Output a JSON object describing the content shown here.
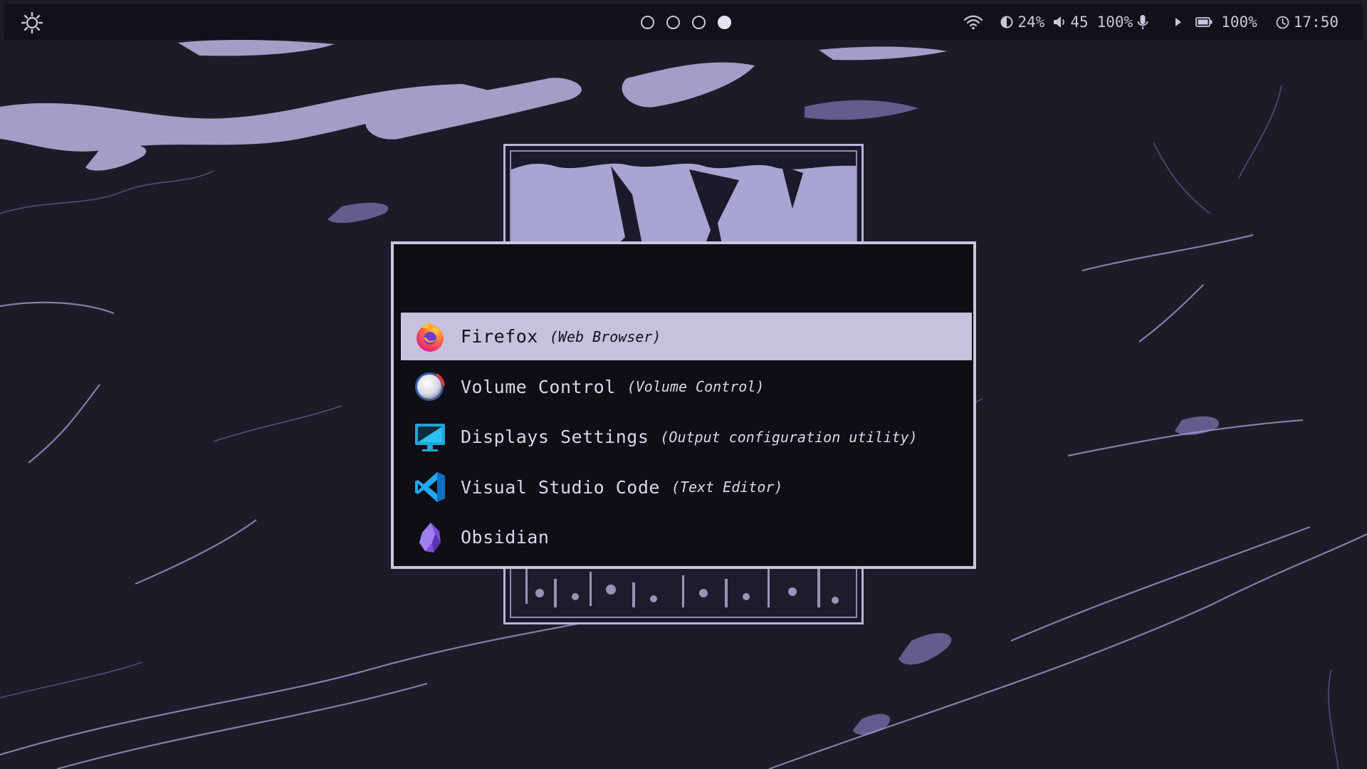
{
  "topbar": {
    "workspaces": [
      {
        "active": false
      },
      {
        "active": false
      },
      {
        "active": false
      },
      {
        "active": true
      }
    ],
    "brightness": "24%",
    "volume": "45",
    "mic_level": "100%",
    "battery": "100%",
    "clock": "17:50"
  },
  "launcher": {
    "search_value": "",
    "items": [
      {
        "name": "Firefox",
        "description": "(Web Browser)",
        "icon": "firefox-icon",
        "selected": true
      },
      {
        "name": "Volume Control",
        "description": "(Volume Control)",
        "icon": "volume-control-icon",
        "selected": false
      },
      {
        "name": "Displays Settings",
        "description": "(Output configuration utility)",
        "icon": "display-settings-icon",
        "selected": false
      },
      {
        "name": "Visual Studio Code",
        "description": "(Text Editor)",
        "icon": "vscode-icon",
        "selected": false
      },
      {
        "name": "Obsidian",
        "description": "",
        "icon": "obsidian-icon",
        "selected": false
      }
    ]
  },
  "colors": {
    "background": "#1d1b27",
    "bar": "#121119",
    "accent": "#c5c2dc",
    "marble_vein": "#a99fd6"
  }
}
